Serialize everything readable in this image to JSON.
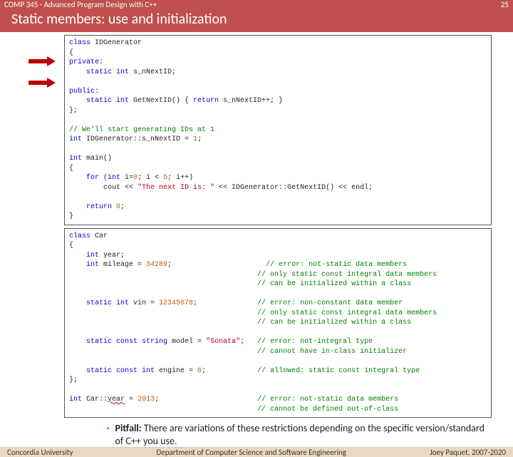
{
  "header": {
    "course": "COMP 345 - Advanced Program Design with C++",
    "page_number": "25"
  },
  "title": "Static members: use and initialization",
  "code1": {
    "l1a": "class",
    "l1b": " IDGenerator",
    "l2": "{",
    "l3a": "private",
    "l3b": ":",
    "l4a": "    static int",
    "l4b": " s_nNextID;",
    "l5": "",
    "l6a": "public",
    "l6b": ":",
    "l7a": "    static int",
    "l7b": " GetNextID() { ",
    "l7c": "return",
    "l7d": " s_nNextID++; }",
    "l8": "};",
    "l9": "",
    "l10": "// We'll start generating IDs at 1",
    "l11a": "int",
    "l11b": " IDGenerator::s_nNextID = ",
    "l11c": "1",
    "l11d": ";",
    "l12": "",
    "l13a": "int",
    "l13b": " main()",
    "l14": "{",
    "l15a": "    for",
    "l15b": " (",
    "l15c": "int",
    "l15d": " i=",
    "l15e": "0",
    "l15f": "; i < ",
    "l15g": "5",
    "l15h": "; i++)",
    "l16a": "        cout << ",
    "l16b": "\"The next ID is: \"",
    "l16c": " << IDGenerator::GetNextID() << endl;",
    "l17": "",
    "l18a": "    return ",
    "l18b": "0",
    "l18c": ";",
    "l19": "}"
  },
  "code2": {
    "l1a": "class",
    "l1b": " Car",
    "l2": "{",
    "l3a": "    int",
    "l3b": " year;",
    "l4a": "    int",
    "l4b": " mileage = ",
    "l4c": "34289",
    "l4d": ";                      ",
    "l4e": "// error: not-static data members",
    "l4f": "// only static const integral data members",
    "l4g": "// can be initialized within a class",
    "l5": "",
    "l6a": "    static int",
    "l6b": " vin = ",
    "l6c": "12345678",
    "l6d": ";              ",
    "l6e": "// error: non-constant data member",
    "l6f": "// only static const integral data members",
    "l6g": "// can be initialized within a class",
    "l7": "",
    "l8a": "    static const",
    "l8b": " ",
    "l8c": "string",
    "l8d": " model = ",
    "l8e": "\"Sonata\"",
    "l8f": ";   ",
    "l8g": "// error: not-integral type",
    "l8h": "// cannot have in-class initializer",
    "l9": "",
    "l10a": "    static const int",
    "l10b": " engine = ",
    "l10c": "6",
    "l10d": ";            ",
    "l10e": "// allowed: static const integral type",
    "l11": "};",
    "l12": "",
    "l13a": "int",
    "l13b": " Car::",
    "l13c": "year",
    "l13d": " = ",
    "l13e": "2013",
    "l13f": ";                       ",
    "l13g": "// error: not-static data members",
    "l13h": "// cannot be defined out-of-class"
  },
  "bullet": {
    "label": "Pitfall:",
    "text": " There are variations of these restrictions depending on the specific version/standard of C++ you use."
  },
  "footer": {
    "left": "Concordia University",
    "center": "Department of Computer Science and Software Engineering",
    "right": "Joey Paquet, 2007-2020"
  }
}
